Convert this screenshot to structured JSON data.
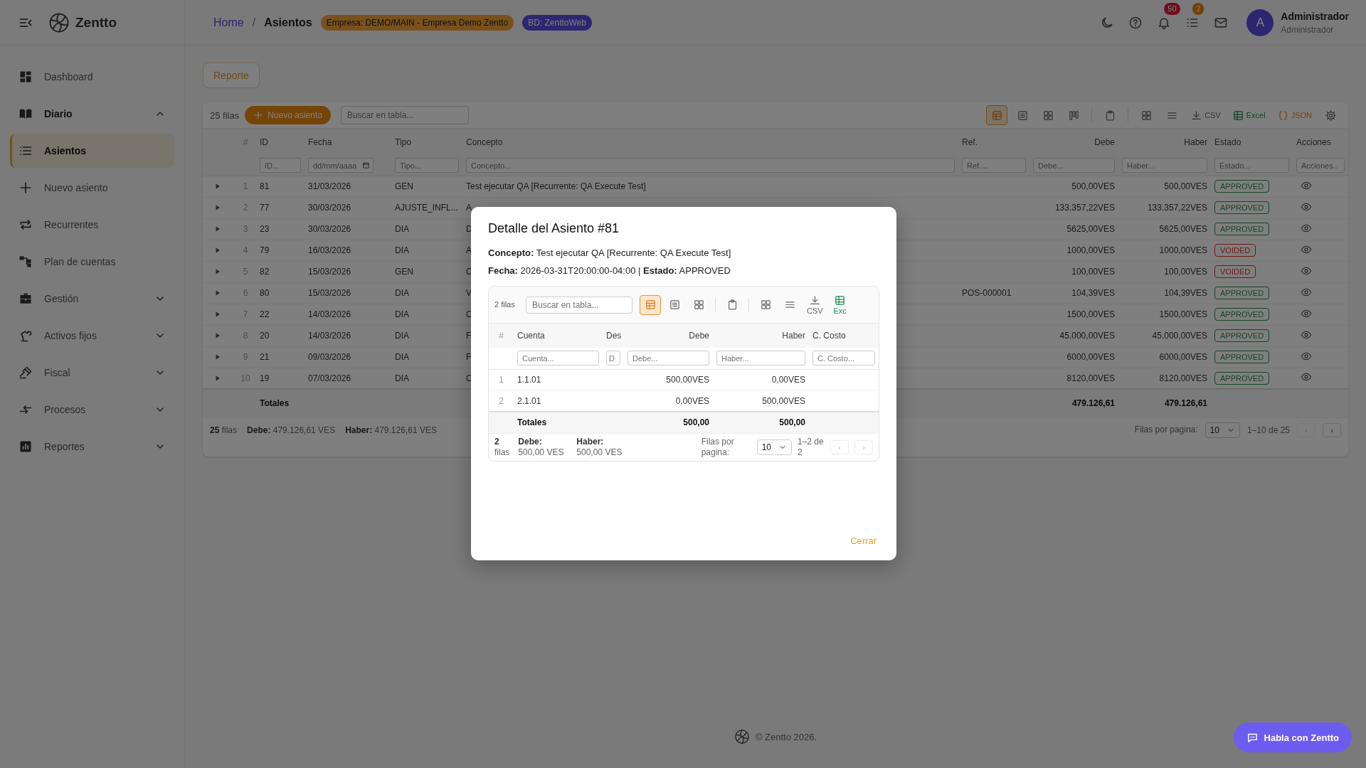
{
  "topbar": {
    "app_name": "Zentto",
    "breadcrumb": [
      {
        "label": "Home",
        "kind": "link"
      },
      {
        "label": "Asientos",
        "kind": "current"
      }
    ],
    "separator": "/",
    "chips": [
      {
        "label": "Empresa: DEMO/MAIN - Empresa Demo Zentto",
        "kind": "company"
      },
      {
        "label": "BD: ZenttoWeb",
        "kind": "database"
      }
    ],
    "actions": [
      {
        "kind": "theme"
      },
      {
        "kind": "help"
      },
      {
        "kind": "notifications",
        "badge": "50"
      },
      {
        "kind": "tasks",
        "badge": "2"
      },
      {
        "kind": "mail"
      }
    ],
    "user": {
      "initial": "A",
      "name": "Administrador",
      "role": "Administrador"
    }
  },
  "sidebar": {
    "items": [
      {
        "label": "Dashboard",
        "selected": false
      },
      {
        "label": "Diario",
        "selected": false,
        "expanded": true,
        "children": [
          {
            "label": "Asientos",
            "selected": true
          },
          {
            "label": "Nuevo asiento",
            "selected": false
          },
          {
            "label": "Recurrentes",
            "selected": false
          },
          {
            "label": "Plan de cuentas",
            "selected": false
          }
        ]
      },
      {
        "label": "Gestión",
        "selected": false,
        "expanded": false
      },
      {
        "label": "Activos fijos",
        "selected": false,
        "expanded": false
      },
      {
        "label": "Fiscal",
        "selected": false,
        "expanded": false
      },
      {
        "label": "Procesos",
        "selected": false,
        "expanded": false
      },
      {
        "label": "Reportes",
        "selected": false,
        "expanded": false
      }
    ]
  },
  "report_button": "Reporte",
  "table": {
    "row_count": "25 filas",
    "new_button": "Nuevo asiento",
    "search": {
      "placeholder": "Buscar en tabla..."
    },
    "tool_groups": [
      [
        {
          "kind": "table-view",
          "selected": true
        },
        {
          "kind": "list-view",
          "selected": false
        },
        {
          "kind": "card-view",
          "selected": false
        },
        {
          "kind": "board-view",
          "selected": false
        }
      ],
      [
        {
          "kind": "copy",
          "selected": false
        }
      ],
      [
        {
          "kind": "layout",
          "selected": false
        },
        {
          "kind": "density",
          "selected": false
        },
        {
          "kind": "csv",
          "label": "CSV",
          "selected": false
        },
        {
          "kind": "excel",
          "label": "Excel",
          "selected": false
        },
        {
          "kind": "json",
          "label": "JSON",
          "selected": false
        },
        {
          "kind": "settings",
          "selected": false
        }
      ]
    ],
    "columns": [
      {
        "label": "#",
        "kind": "index"
      },
      {
        "label": "ID",
        "placeholder": "ID..."
      },
      {
        "label": "Fecha",
        "placeholder": "dd/mm/aaaa",
        "kind": "date"
      },
      {
        "label": "Tipo",
        "placeholder": "Tipo..."
      },
      {
        "label": "Concepto",
        "placeholder": "Concepto..."
      },
      {
        "label": "Ref.",
        "placeholder": "Ref...."
      },
      {
        "label": "Debe",
        "placeholder": "Debe...",
        "kind": "amount"
      },
      {
        "label": "Haber",
        "placeholder": "Haber...",
        "kind": "amount"
      },
      {
        "label": "Estado",
        "placeholder": "Estado..."
      },
      {
        "label": "Acciones",
        "placeholder": "Acciones.."
      }
    ],
    "rows": [
      {
        "expanded": false,
        "num": "1",
        "id": "81",
        "fecha": "31/03/2026",
        "tipo": "GEN",
        "concepto": "Test ejecutar QA [Recurrente: QA Execute Test]",
        "debe": "500,00VES",
        "haber": "500,00VES",
        "status": {
          "label": "APPROVED",
          "kind": "approved"
        }
      },
      {
        "expanded": false,
        "num": "2",
        "id": "77",
        "fecha": "30/03/2026",
        "tipo": "AJUSTE_INFL...",
        "concepto": "A",
        "debe": "133.357,22VES",
        "haber": "133.357,22VES",
        "status": {
          "label": "APPROVED",
          "kind": "approved"
        }
      },
      {
        "expanded": false,
        "num": "3",
        "id": "23",
        "fecha": "30/03/2026",
        "tipo": "DIA",
        "concepto": "D",
        "debe": "5625,00VES",
        "haber": "5625,00VES",
        "status": {
          "label": "APPROVED",
          "kind": "approved"
        }
      },
      {
        "expanded": false,
        "num": "4",
        "id": "79",
        "fecha": "16/03/2026",
        "tipo": "DIA",
        "concepto": "A",
        "debe": "1000,00VES",
        "haber": "1000,00VES",
        "status": {
          "label": "VOIDED",
          "kind": "voided"
        }
      },
      {
        "expanded": false,
        "num": "5",
        "id": "82",
        "fecha": "15/03/2026",
        "tipo": "GEN",
        "concepto": "C",
        "debe": "100,00VES",
        "haber": "100,00VES",
        "status": {
          "label": "VOIDED",
          "kind": "voided"
        }
      },
      {
        "expanded": false,
        "num": "6",
        "id": "80",
        "fecha": "15/03/2026",
        "tipo": "DIA",
        "concepto": "V",
        "ref": "POS-000001",
        "debe": "104,39VES",
        "haber": "104,39VES",
        "status": {
          "label": "APPROVED",
          "kind": "approved"
        }
      },
      {
        "expanded": false,
        "num": "7",
        "id": "22",
        "fecha": "14/03/2026",
        "tipo": "DIA",
        "concepto": "C",
        "debe": "1500,00VES",
        "haber": "1500,00VES",
        "status": {
          "label": "APPROVED",
          "kind": "approved"
        }
      },
      {
        "expanded": false,
        "num": "8",
        "id": "20",
        "fecha": "14/03/2026",
        "tipo": "DIA",
        "concepto": "F",
        "debe": "45.000,00VES",
        "haber": "45.000,00VES",
        "status": {
          "label": "APPROVED",
          "kind": "approved"
        }
      },
      {
        "expanded": false,
        "num": "9",
        "id": "21",
        "fecha": "09/03/2026",
        "tipo": "DIA",
        "concepto": "F",
        "debe": "6000,00VES",
        "haber": "6000,00VES",
        "status": {
          "label": "APPROVED",
          "kind": "approved"
        }
      },
      {
        "expanded": false,
        "num": "10",
        "id": "19",
        "fecha": "07/03/2026",
        "tipo": "DIA",
        "concepto": "C",
        "debe": "8120,00VES",
        "haber": "8120,00VES",
        "status": {
          "label": "APPROVED",
          "kind": "approved"
        }
      }
    ],
    "totals": {
      "label": "Totales",
      "debe": "479.126,61",
      "haber": "479.126,61"
    },
    "summary": [
      "**25** filas",
      "**Debe:** 479.126,61 VES",
      "**Haber:** 479.126,61 VES"
    ],
    "pagination": {
      "label": "Filas por pagina:",
      "page_size": "10",
      "range": "1–10 de 25",
      "prev": {
        "label": "‹",
        "disabled": true
      },
      "next": {
        "label": "›",
        "disabled": false
      }
    }
  },
  "modal": {
    "title": "Detalle del Asiento #81",
    "details": [
      "**Concepto:** Test ejecutar QA [Recurrente: QA Execute Test]",
      "**Fecha:** 2026-03-31T20:00:00-04:00 | **Estado:** APPROVED"
    ],
    "table": {
      "row_count": "2 filas",
      "search": {
        "placeholder": "Buscar en tabla..."
      },
      "tool_groups": [
        [
          {
            "kind": "table-view",
            "selected": true
          },
          {
            "kind": "list-view",
            "selected": false
          },
          {
            "kind": "card-view",
            "selected": false
          }
        ],
        [
          {
            "kind": "copy",
            "selected": false
          }
        ],
        [
          {
            "kind": "layout",
            "selected": false
          },
          {
            "kind": "density",
            "selected": false
          },
          {
            "kind": "csv",
            "label": "CSV",
            "selected": false
          },
          {
            "kind": "excel",
            "label": "Exc",
            "selected": false
          }
        ]
      ],
      "columns": [
        {
          "label": "#",
          "kind": "index"
        },
        {
          "label": "Cuenta",
          "placeholder": "Cuenta..."
        },
        {
          "label": "Des",
          "placeholder": "D"
        },
        {
          "label": "Debe",
          "placeholder": "Debe...",
          "kind": "amount"
        },
        {
          "label": "Haber",
          "placeholder": "Haber...",
          "kind": "amount"
        },
        {
          "label": "C. Costo",
          "placeholder": "C. Costo..."
        }
      ],
      "rows": [
        {
          "num": "1",
          "cuenta": "1.1.01",
          "debe": "500,00VES",
          "haber": "0,00VES"
        },
        {
          "num": "2",
          "cuenta": "2.1.01",
          "debe": "0,00VES",
          "haber": "500,00VES"
        }
      ],
      "totals": {
        "label": "Totales",
        "debe": "500,00",
        "haber": "500,00"
      },
      "summary": [
        "**2** filas",
        "**Debe:** 500,00 VES",
        "**Haber:** 500,00 VES"
      ],
      "pagination": {
        "label": "Filas por pagina:",
        "page_size": "10",
        "range": "1–2 de 2",
        "prev": {
          "label": "‹",
          "disabled": true
        },
        "next": {
          "label": "›",
          "disabled": true
        }
      }
    },
    "close_button": "Cerrar"
  },
  "footer": "© Zentto 2026.",
  "chat_button": "Habla con Zentto"
}
